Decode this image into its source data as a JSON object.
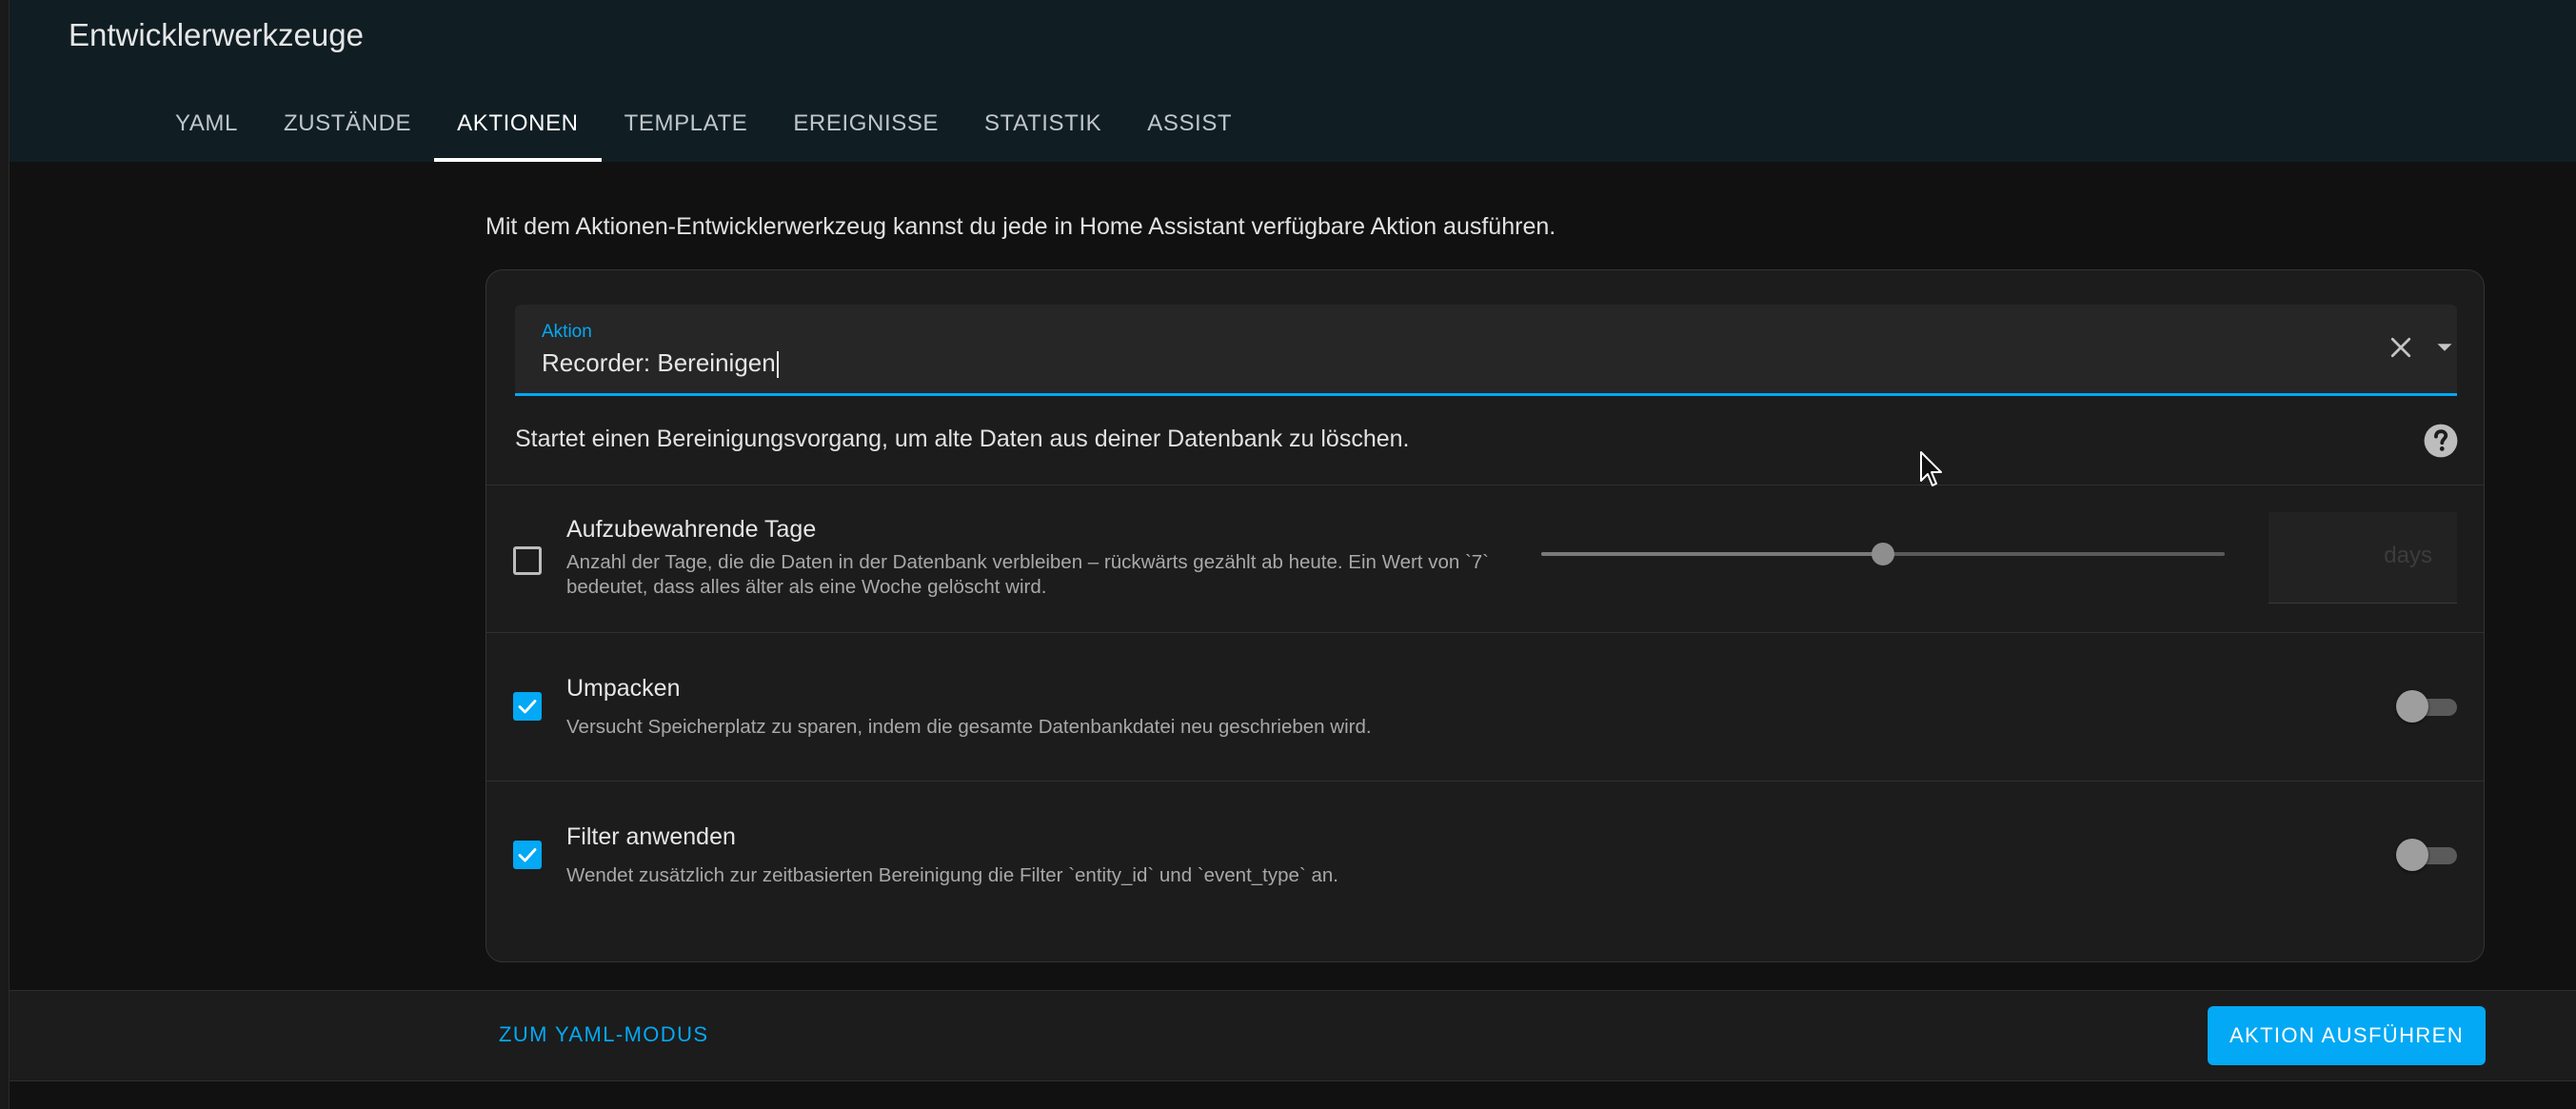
{
  "header": {
    "title": "Entwicklerwerkzeuge",
    "tabs": [
      {
        "label": "YAML",
        "active": false
      },
      {
        "label": "ZUSTÄNDE",
        "active": false
      },
      {
        "label": "AKTIONEN",
        "active": true
      },
      {
        "label": "TEMPLATE",
        "active": false
      },
      {
        "label": "EREIGNISSE",
        "active": false
      },
      {
        "label": "STATISTIK",
        "active": false
      },
      {
        "label": "ASSIST",
        "active": false
      }
    ]
  },
  "main": {
    "intro": "Mit dem Aktionen-Entwicklerwerkzeug kannst du jede in Home Assistant verfügbare Aktion ausführen.",
    "action_field": {
      "label": "Aktion",
      "value": "Recorder: Bereinigen"
    },
    "service_description": "Startet einen Bereinigungsvorgang, um alte Daten aus deiner Datenbank zu löschen.",
    "fields": {
      "keep_days": {
        "title": "Aufzubewahrende Tage",
        "description": "Anzahl der Tage, die die Daten in der Datenbank verbleiben – rückwärts gezählt ab heute. Ein Wert von `7` bedeutet, dass alles älter als eine Woche gelöscht wird.",
        "checked": false,
        "slider_fraction": 0.5,
        "suffix": "days"
      },
      "repack": {
        "title": "Umpacken",
        "description": "Versucht Speicherplatz zu sparen, indem die gesamte Datenbankdatei neu geschrieben wird.",
        "checked": true,
        "toggle_on": false
      },
      "apply_filter": {
        "title": "Filter anwenden",
        "description": "Wendet zusätzlich zur zeitbasierten Bereinigung die Filter `entity_id` und `event_type` an.",
        "checked": true,
        "toggle_on": false
      }
    }
  },
  "footer": {
    "yaml_mode_label": "ZUM YAML-MODUS",
    "run_label": "AKTION AUSFÜHREN"
  },
  "colors": {
    "accent": "#03a9f4",
    "header_bg": "#101e24",
    "page_bg": "#111111",
    "card_bg": "#1c1c1c"
  }
}
